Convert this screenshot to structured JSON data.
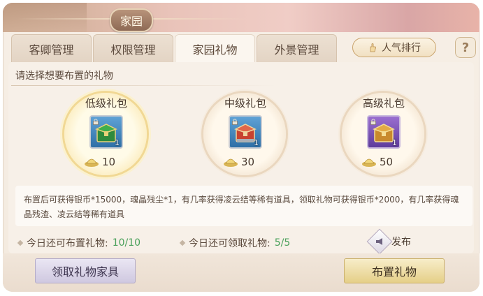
{
  "header": {
    "title": "家园"
  },
  "tabs": [
    {
      "label": "客卿管理",
      "active": false
    },
    {
      "label": "权限管理",
      "active": false
    },
    {
      "label": "家园礼物",
      "active": true
    },
    {
      "label": "外景管理",
      "active": false
    }
  ],
  "rank_button": {
    "label": "人气排行",
    "icon": "hand-icon"
  },
  "help_button": {
    "label": "?"
  },
  "prompt": "请选择想要布置的礼物",
  "gifts": [
    {
      "name": "低级礼包",
      "count": "1",
      "cost": "10",
      "color": "#3a9b45",
      "selected": true
    },
    {
      "name": "中级礼包",
      "count": "1",
      "cost": "30",
      "color": "#d9563a",
      "selected": false
    },
    {
      "name": "高级礼包",
      "count": "1",
      "cost": "50",
      "color": "#c98a2d",
      "selected": false
    }
  ],
  "info": "布置后可获得银币*15000，魂晶残尘*1，有几率获得凌云结等稀有道具，领取礼物可获得银币*2000，有几率获得魂晶残渣、凌云结等稀有道具",
  "stats": {
    "place_label": "今日还可布置礼物:",
    "place_value": "10/10",
    "claim_label": "今日还可领取礼物:",
    "claim_value": "5/5"
  },
  "publish": {
    "label": "发布"
  },
  "buttons": {
    "claim_furniture": "领取礼物家具",
    "place_gift": "布置礼物"
  }
}
